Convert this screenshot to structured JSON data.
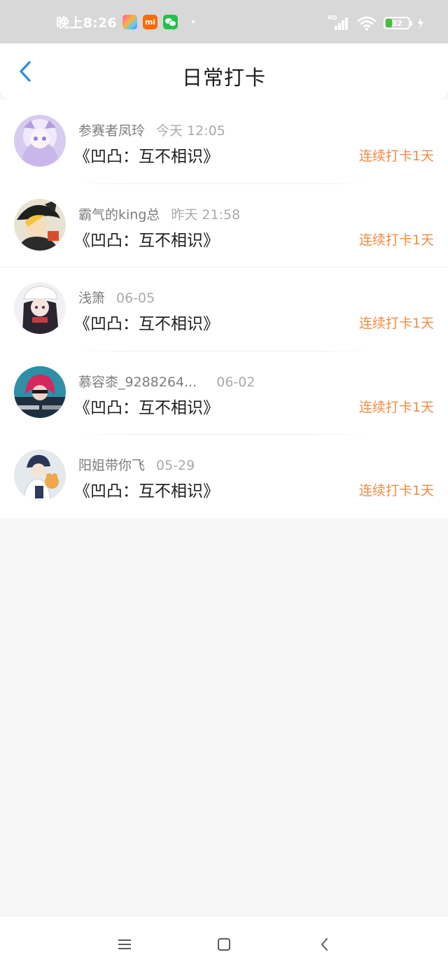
{
  "status_bar": {
    "time": "晚上8:26",
    "mi_label": "mi",
    "network_label": "HD",
    "battery_level": "32"
  },
  "header": {
    "title": "日常打卡"
  },
  "checkins": [
    {
      "username": "参赛者凤玲",
      "time": "今天 12:05",
      "course": "《凹凸：互不相识》",
      "streak": "连续打卡1天"
    },
    {
      "username": "霸气的king总",
      "time": "昨天 21:58",
      "course": "《凹凸：互不相识》",
      "streak": "连续打卡1天"
    },
    {
      "username": "浅箫",
      "time": "06-05",
      "course": "《凹凸：互不相识》",
      "streak": "连续打卡1天"
    },
    {
      "username": "慕容桼_9288264...",
      "time": "06-02",
      "course": "《凹凸：互不相识》",
      "streak": "连续打卡1天"
    },
    {
      "username": "阳姐带你飞",
      "time": "05-29",
      "course": "《凹凸：互不相识》",
      "streak": "连续打卡1天"
    }
  ],
  "colors": {
    "accent_orange": "#f08b43",
    "back_arrow_blue": "#2b8be6"
  }
}
